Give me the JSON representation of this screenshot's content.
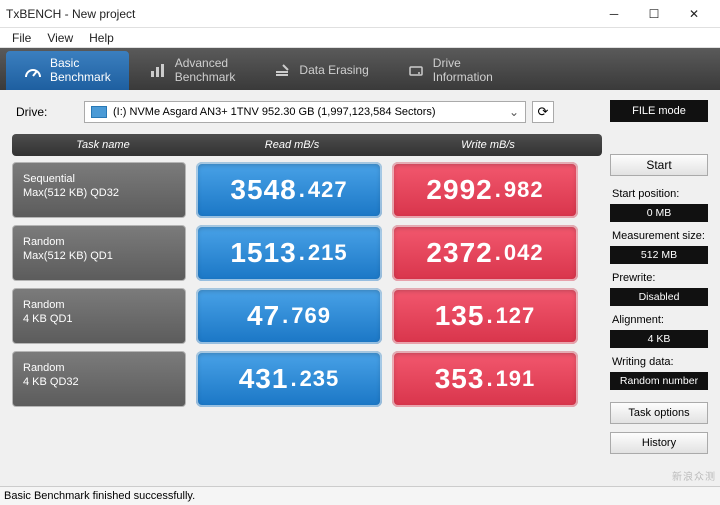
{
  "window": {
    "title": "TxBENCH - New project"
  },
  "menu": {
    "file": "File",
    "view": "View",
    "help": "Help"
  },
  "tabs": {
    "basic": "Basic\nBenchmark",
    "advanced": "Advanced\nBenchmark",
    "erasing": "Data Erasing",
    "driveinfo": "Drive\nInformation"
  },
  "drive": {
    "label": "Drive:",
    "value": "(I:) NVMe Asgard AN3+ 1TNV  952.30 GB (1,997,123,584 Sectors)"
  },
  "headers": {
    "task": "Task name",
    "read": "Read mB/s",
    "write": "Write mB/s"
  },
  "rows": [
    {
      "name_l1": "Sequential",
      "name_l2": "Max(512 KB) QD32",
      "read_i": "3548",
      "read_f": "427",
      "write_i": "2992",
      "write_f": "982"
    },
    {
      "name_l1": "Random",
      "name_l2": "Max(512 KB) QD1",
      "read_i": "1513",
      "read_f": "215",
      "write_i": "2372",
      "write_f": "042"
    },
    {
      "name_l1": "Random",
      "name_l2": "4 KB QD1",
      "read_i": "47",
      "read_f": "769",
      "write_i": "135",
      "write_f": "127"
    },
    {
      "name_l1": "Random",
      "name_l2": "4 KB QD32",
      "read_i": "431",
      "read_f": "235",
      "write_i": "353",
      "write_f": "191"
    }
  ],
  "side": {
    "filemode": "FILE mode",
    "start": "Start",
    "startpos_lbl": "Start position:",
    "startpos_val": "0 MB",
    "meas_lbl": "Measurement size:",
    "meas_val": "512 MB",
    "prewrite_lbl": "Prewrite:",
    "prewrite_val": "Disabled",
    "align_lbl": "Alignment:",
    "align_val": "4 KB",
    "wdata_lbl": "Writing data:",
    "wdata_val": "Random number",
    "taskopt": "Task options",
    "history": "History"
  },
  "status": "Basic Benchmark finished successfully.",
  "watermark": "新浪众测"
}
